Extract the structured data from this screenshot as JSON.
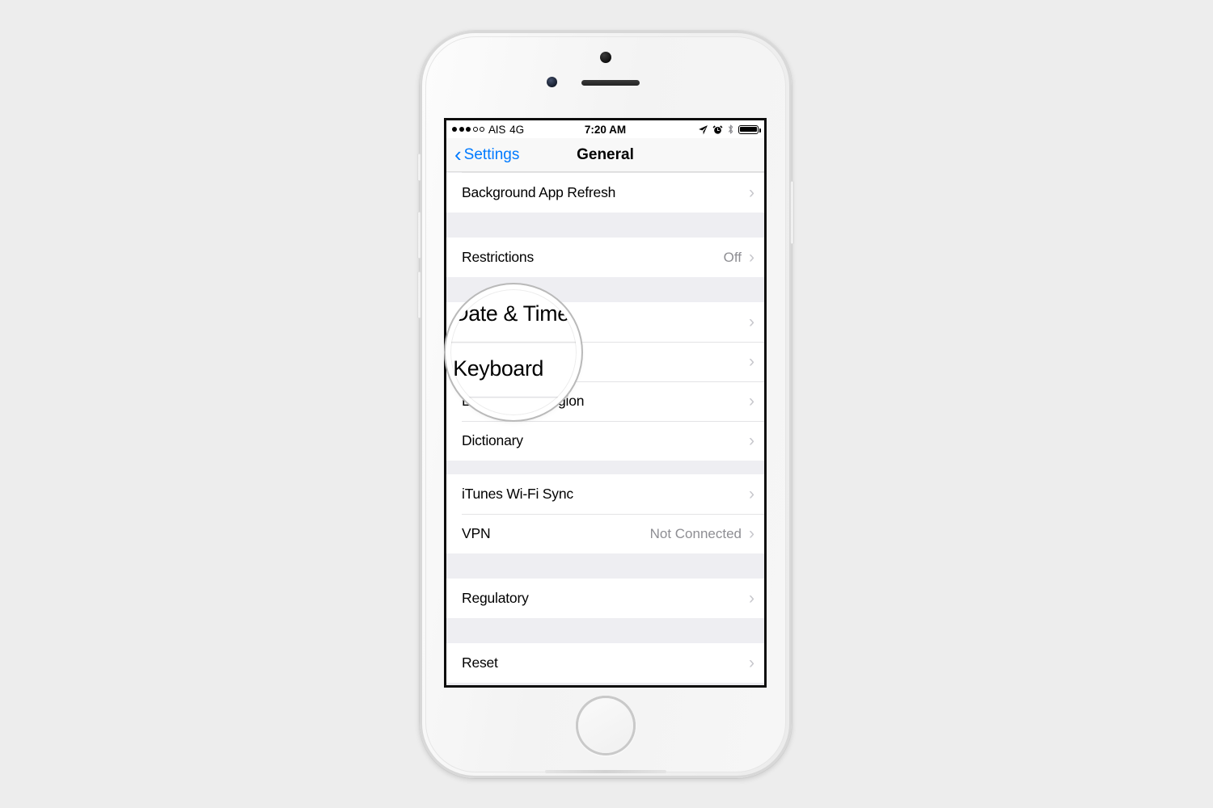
{
  "device": {
    "name": "iPhone",
    "color": "silver-white",
    "controls": {
      "silence_switch": "silence-switch",
      "volume_up": "volume-up-button",
      "volume_down": "volume-down-button",
      "power": "power-button",
      "home": "home-button"
    }
  },
  "status_bar": {
    "signal_bars_filled": 3,
    "signal_bars_total": 5,
    "carrier": "AIS",
    "network": "4G",
    "time": "7:20 AM",
    "icons": [
      "location-arrow-icon",
      "alarm-clock-icon",
      "bluetooth-icon",
      "battery-icon"
    ],
    "battery_level": "100"
  },
  "nav": {
    "back_label": "Settings",
    "title": "General"
  },
  "list": {
    "chevron": "›",
    "sections": [
      {
        "rows": [
          {
            "label": "Background App Refresh",
            "value": "",
            "chevron": true
          }
        ]
      },
      {
        "rows": [
          {
            "label": "Restrictions",
            "value": "Off",
            "chevron": true
          }
        ]
      },
      {
        "rows": [
          {
            "label": "Date & Time",
            "value": "",
            "chevron": true
          },
          {
            "label": "Keyboard",
            "value": "",
            "chevron": true
          },
          {
            "label": "Language & Region",
            "value": "",
            "chevron": true
          },
          {
            "label": "Dictionary",
            "value": "",
            "chevron": true
          }
        ]
      },
      {
        "rows": [
          {
            "label": "iTunes Wi-Fi Sync",
            "value": "",
            "chevron": true
          },
          {
            "label": "VPN",
            "value": "Not Connected",
            "chevron": true
          }
        ]
      },
      {
        "rows": [
          {
            "label": "Regulatory",
            "value": "",
            "chevron": true
          }
        ]
      },
      {
        "rows": [
          {
            "label": "Reset",
            "value": "",
            "chevron": true
          }
        ]
      }
    ]
  },
  "magnifier": {
    "target_row": "Keyboard",
    "rows": [
      "Date & Time",
      "Keyboard",
      "Language &"
    ],
    "ring_color": "#b9b9b9"
  },
  "colors": {
    "page_background": "#ededed",
    "accent_blue": "#007aff",
    "list_gap": "#eeeef2",
    "separator": "#e3e3e5",
    "secondary_text": "#8e8e93",
    "chevron": "#c7c7cc"
  }
}
